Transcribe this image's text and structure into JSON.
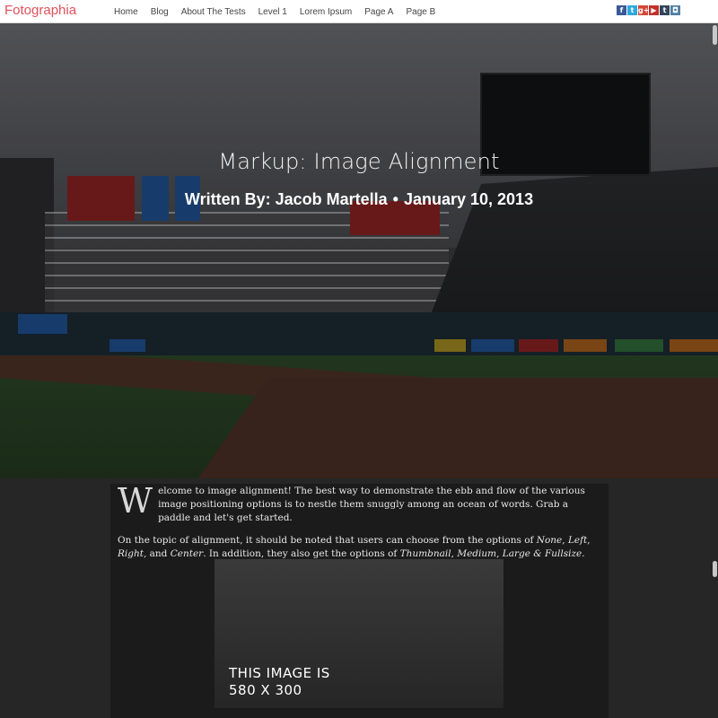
{
  "brand": "Fotographia",
  "nav": [
    "Home",
    "Blog",
    "About The Tests",
    "Level 1",
    "Lorem Ipsum",
    "Page A",
    "Page B"
  ],
  "social": {
    "facebook": "f",
    "twitter": "t",
    "googleplus": "g+",
    "youtube": "▶",
    "tumblr": "t",
    "instagram": "◘"
  },
  "post": {
    "title": "Markup: Image Alignment",
    "byline_author": "Written By: Jacob Martella",
    "byline_sep": "•",
    "byline_date": "January 10, 2013"
  },
  "content": {
    "dropcap": "W",
    "para1": "elcome to image alignment! The best way to demonstrate the ebb and flow of the various image positioning options is to nestle them snuggly among an ocean of words. Grab a paddle and let's get started.",
    "para2_a": "On the topic of alignment, it should be noted that users can choose from the options of ",
    "para2_none": "None",
    "para2_c1": ", ",
    "para2_left": "Left",
    "para2_c2": ", ",
    "para2_right": "Right,",
    "para2_and": " and ",
    "para2_center": "Center",
    "para2_b": ". In addition, they also get the options of ",
    "para2_thumb": "Thumbnail",
    "para2_c3": ", ",
    "para2_medium": "Medium",
    "para2_c4": ", ",
    "para2_large": "Large & Fullsize",
    "para2_end": ".",
    "image_line1": "THIS IMAGE IS",
    "image_line2": "580 X 300"
  }
}
